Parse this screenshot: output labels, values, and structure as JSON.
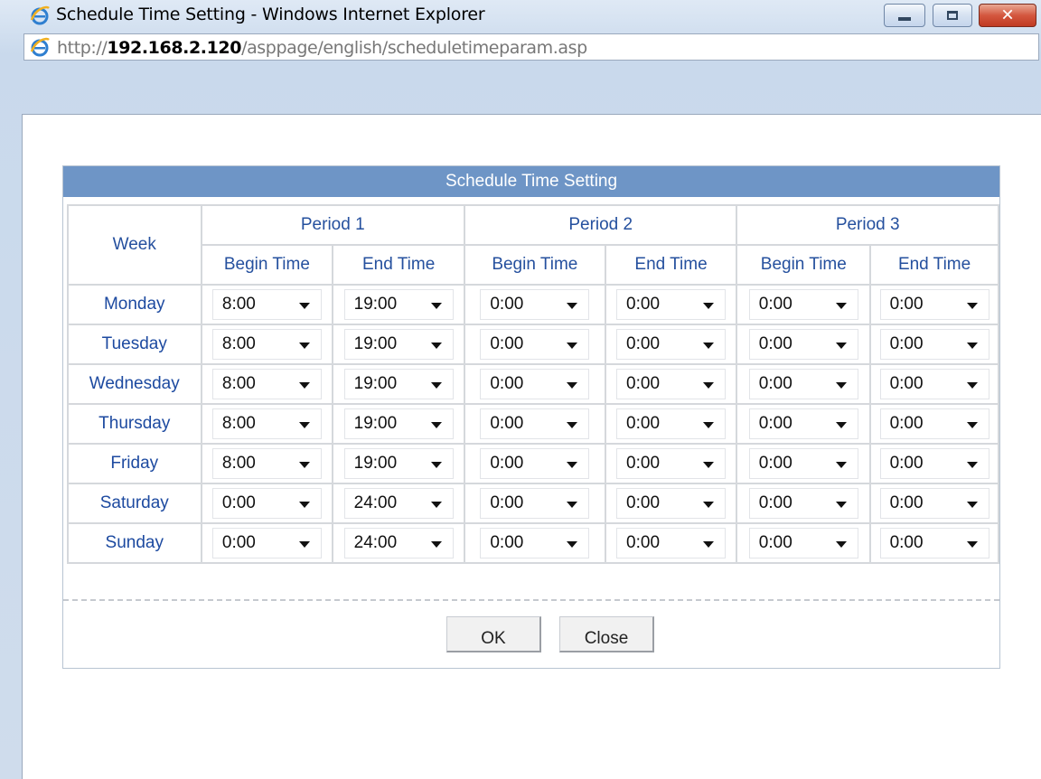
{
  "window": {
    "title": "Schedule Time Setting - Windows Internet Explorer",
    "url_prefix": "http://",
    "url_host": "192.168.2.120",
    "url_path": "/asppage/english/scheduletimeparam.asp",
    "close_glyph": "✕"
  },
  "panel": {
    "heading": "Schedule Time Setting",
    "week_header": "Week",
    "period1": "Period 1",
    "period2": "Period 2",
    "period3": "Period 3",
    "begin_time": "Begin Time",
    "end_time": "End Time"
  },
  "schedule": [
    {
      "day": "Monday",
      "times": [
        "8:00",
        "19:00",
        "0:00",
        "0:00",
        "0:00",
        "0:00"
      ]
    },
    {
      "day": "Tuesday",
      "times": [
        "8:00",
        "19:00",
        "0:00",
        "0:00",
        "0:00",
        "0:00"
      ]
    },
    {
      "day": "Wednesday",
      "times": [
        "8:00",
        "19:00",
        "0:00",
        "0:00",
        "0:00",
        "0:00"
      ]
    },
    {
      "day": "Thursday",
      "times": [
        "8:00",
        "19:00",
        "0:00",
        "0:00",
        "0:00",
        "0:00"
      ]
    },
    {
      "day": "Friday",
      "times": [
        "8:00",
        "19:00",
        "0:00",
        "0:00",
        "0:00",
        "0:00"
      ]
    },
    {
      "day": "Saturday",
      "times": [
        "0:00",
        "24:00",
        "0:00",
        "0:00",
        "0:00",
        "0:00"
      ]
    },
    {
      "day": "Sunday",
      "times": [
        "0:00",
        "24:00",
        "0:00",
        "0:00",
        "0:00",
        "0:00"
      ]
    }
  ],
  "buttons": {
    "ok": "OK",
    "close": "Close"
  },
  "colors": {
    "header_blue": "#6e95c6",
    "label_blue": "#25509e"
  },
  "icons": {
    "title_icon": "ie-logo-icon",
    "address_icon": "ie-page-icon"
  }
}
